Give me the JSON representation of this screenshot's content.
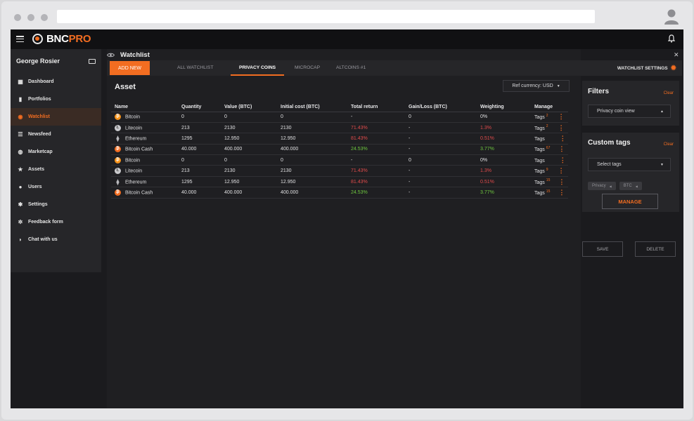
{
  "app": {
    "brand_left": "BNC",
    "brand_right": "PRO"
  },
  "user": {
    "name": "George Rosier"
  },
  "sidebar": {
    "items": [
      {
        "label": "Dashboard",
        "icon": "dashboard-icon",
        "active": false
      },
      {
        "label": "Portfolios",
        "icon": "bar-chart-icon",
        "active": false
      },
      {
        "label": "Watchlist",
        "icon": "eye-icon",
        "active": true
      },
      {
        "label": "Newsfeed",
        "icon": "list-icon",
        "active": false
      },
      {
        "label": "Marketcap",
        "icon": "gauge-icon",
        "active": false
      },
      {
        "label": "Assets",
        "icon": "star-icon",
        "active": false
      },
      {
        "label": "Users",
        "icon": "users-icon",
        "active": false
      },
      {
        "label": "Settings",
        "icon": "gear-icon",
        "active": false
      },
      {
        "label": "Feedback form",
        "icon": "bug-icon",
        "active": false
      },
      {
        "label": "Chat with us",
        "icon": "chat-icon",
        "active": false
      }
    ]
  },
  "watchlist": {
    "title": "Watchlist",
    "add_new": "ADD NEW",
    "tabs": [
      "ALL WATCHLIST",
      "PRIVACY COINS",
      "MICROCAP",
      "ALTCOINS #1"
    ],
    "active_tab": 1,
    "settings_label": "WATCHLIST SETTINGS"
  },
  "asset": {
    "title": "Asset",
    "ref_currency": "Ref currency: USD"
  },
  "table": {
    "columns": [
      "Name",
      "Quantity",
      "Value (BTC)",
      "Initial cost (BTC)",
      "Total return",
      "Gain/Loss (BTC)",
      "Weighting",
      "Manage"
    ],
    "rows": [
      {
        "coin": "btc",
        "name": "Bitcoin",
        "quantity": "0",
        "value": "0",
        "initial": "0",
        "return": "-",
        "return_color": "",
        "gain": "0",
        "weighting": "0%",
        "weight_color": "",
        "tags": "Tags",
        "tag_count": "2"
      },
      {
        "coin": "ltc",
        "name": "Litecoin",
        "quantity": "213",
        "value": "2130",
        "initial": "2130",
        "return": "71.43%",
        "return_color": "red",
        "gain": "-",
        "weighting": "1.3%",
        "weight_color": "red",
        "tags": "Tags",
        "tag_count": "2"
      },
      {
        "coin": "eth",
        "name": "Ethereum",
        "quantity": "1295",
        "value": "12.950",
        "initial": "12.950",
        "return": "81.43%",
        "return_color": "red",
        "gain": "-",
        "weighting": "0.51%",
        "weight_color": "red",
        "tags": "Tags",
        "tag_count": ""
      },
      {
        "coin": "bch",
        "name": "Bitcoin Cash",
        "quantity": "40.000",
        "value": "400.000",
        "initial": "400.000",
        "return": "24.53%",
        "return_color": "green",
        "gain": "-",
        "weighting": "3.77%",
        "weight_color": "green",
        "tags": "Tags",
        "tag_count": "67"
      },
      {
        "coin": "btc",
        "name": "Bitcoin",
        "quantity": "0",
        "value": "0",
        "initial": "0",
        "return": "-",
        "return_color": "",
        "gain": "0",
        "weighting": "0%",
        "weight_color": "",
        "tags": "Tags",
        "tag_count": ""
      },
      {
        "coin": "ltc",
        "name": "Litecoin",
        "quantity": "213",
        "value": "2130",
        "initial": "2130",
        "return": "71.43%",
        "return_color": "red",
        "gain": "-",
        "weighting": "1.3%",
        "weight_color": "red",
        "tags": "Tags",
        "tag_count": "9"
      },
      {
        "coin": "eth",
        "name": "Ethereum",
        "quantity": "1295",
        "value": "12.950",
        "initial": "12.950",
        "return": "81.43%",
        "return_color": "red",
        "gain": "-",
        "weighting": "0.51%",
        "weight_color": "red",
        "tags": "Tags",
        "tag_count": "15"
      },
      {
        "coin": "bch",
        "name": "Bitcoin Cash",
        "quantity": "40.000",
        "value": "400.000",
        "initial": "400.000",
        "return": "24.53%",
        "return_color": "green",
        "gain": "-",
        "weighting": "3.77%",
        "weight_color": "green",
        "tags": "Tags",
        "tag_count": "15"
      }
    ]
  },
  "filters": {
    "title": "Filters",
    "clear": "Clear",
    "view_select": "Privacy coin view"
  },
  "custom_tags": {
    "title": "Custom tags",
    "clear": "Clear",
    "select_placeholder": "Select tags",
    "chips": [
      "Privacy",
      "BTC"
    ],
    "manage": "MANAGE"
  },
  "actions": {
    "save": "SAVE",
    "delete": "DELETE"
  },
  "colors": {
    "accent": "#f26d21",
    "negative": "#e04b4b",
    "positive": "#6ec63f"
  }
}
